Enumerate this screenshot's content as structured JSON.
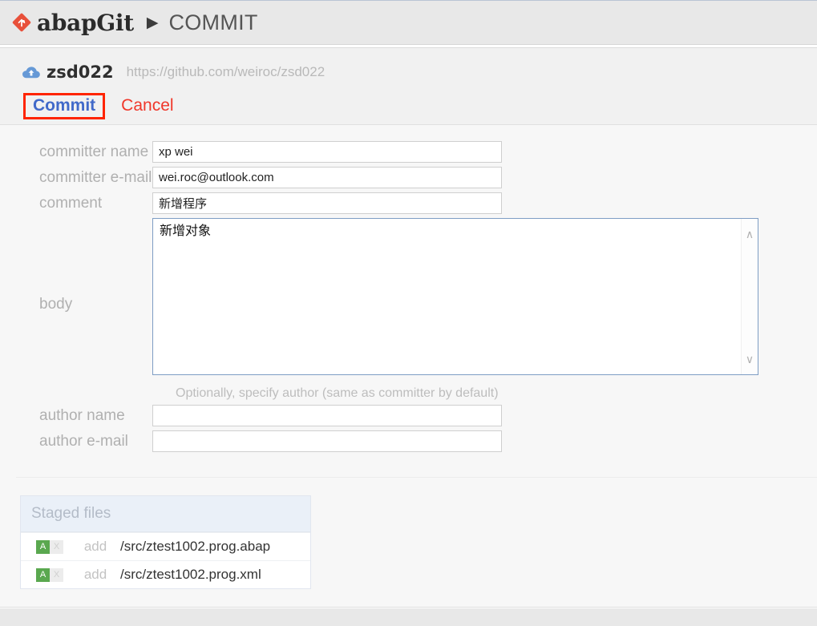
{
  "header": {
    "logo_icon": "abapgit-logo-icon",
    "brand": "abapGit",
    "separator": "▶",
    "page_title": "COMMIT",
    "brand_color": "#e8503a"
  },
  "repo": {
    "status_icon": "cloud-upload-icon",
    "name": "zsd022",
    "url": "https://github.com/weiroc/zsd022",
    "actions": {
      "commit_label": "Commit",
      "commit_color": "#4169c9",
      "commit_highlight_color": "#ff2400",
      "cancel_label": "Cancel",
      "cancel_color": "#f0372a"
    }
  },
  "form": {
    "committer_name": {
      "label": "committer name",
      "value": "xp wei",
      "placeholder": ""
    },
    "committer_email": {
      "label": "committer e-mail",
      "value": "wei.roc@outlook.com",
      "placeholder": ""
    },
    "comment": {
      "label": "comment",
      "value": "新增程序",
      "placeholder": ""
    },
    "body": {
      "label": "body",
      "value": "新增对象",
      "placeholder": "",
      "scroll_up_icon": "chevron-up-icon",
      "scroll_down_icon": "chevron-down-icon"
    },
    "author_hint": "Optionally, specify author (same as committer by default)",
    "author_name": {
      "label": "author name",
      "value": "",
      "placeholder": ""
    },
    "author_email": {
      "label": "author e-mail",
      "value": "",
      "placeholder": ""
    }
  },
  "staged": {
    "title": "Staged files",
    "rows": [
      {
        "add_flag": "A",
        "remove_flag": "X",
        "action": "add",
        "path": "/src/ztest1002.prog.abap"
      },
      {
        "add_flag": "A",
        "remove_flag": "X",
        "action": "add",
        "path": "/src/ztest1002.prog.xml"
      }
    ]
  }
}
